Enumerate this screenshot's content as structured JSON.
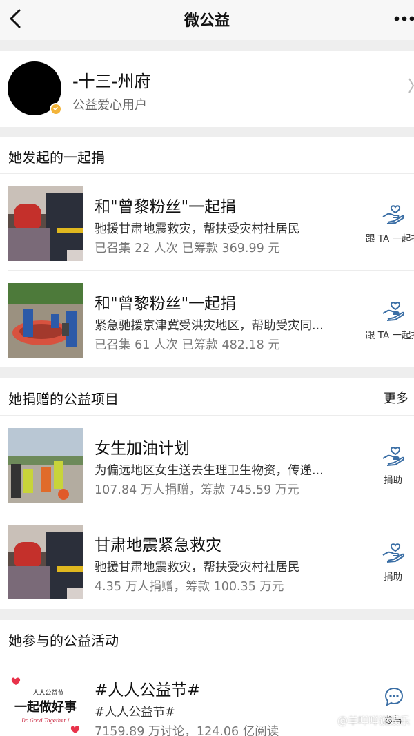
{
  "navbar": {
    "title": "微公益"
  },
  "profile": {
    "name": "-十三-州府",
    "subtitle": "公益爱心用户"
  },
  "initiated": {
    "title": "她发起的一起捐",
    "items": [
      {
        "title": "和\"曾黎粉丝\"一起捐",
        "desc": "驰援甘肃地震救灾，帮扶受灾村社居民",
        "stat": "已召集 22 人次 已筹款 369.99 元",
        "action": "跟 TA 一起捐"
      },
      {
        "title": "和\"曾黎粉丝\"一起捐",
        "desc": "紧急驰援京津冀受洪灾地区，帮助受灾同...",
        "stat": "已召集 61 人次 已筹款 482.18 元",
        "action": "跟 TA 一起捐"
      }
    ]
  },
  "donated": {
    "title": "她捐赠的公益项目",
    "more": "更多",
    "items": [
      {
        "title": "女生加油计划",
        "desc": "为偏远地区女生送去生理卫生物资，传递...",
        "stat": "107.84 万人捐赠，筹款 745.59 万元",
        "action": "捐助"
      },
      {
        "title": "甘肃地震紧急救灾",
        "desc": "驰援甘肃地震救灾，帮扶受灾村社居民",
        "stat": "4.35 万人捐赠，筹款 100.35 万元",
        "action": "捐助"
      }
    ]
  },
  "activities": {
    "title": "她参与的公益活动",
    "items": [
      {
        "title": "#人人公益节#",
        "desc": "#人人公益节#",
        "stat": "7159.89 万讨论，124.06 亿阅读",
        "action": "参与",
        "thumb_logo": "人人公益节",
        "thumb_main": "一起做好事",
        "thumb_sub": "Do Good Together !"
      }
    ]
  },
  "watermark": "@羊咩咩说娱乐",
  "icons": {
    "back": "chevron-left-icon",
    "more": "more-dots-icon",
    "donate": "hand-heart-icon",
    "comment": "chat-bubble-icon",
    "verified": "verified-badge-icon"
  },
  "colors": {
    "accent": "#3a6ea5",
    "badge": "#f3b43a",
    "background": "#eeeeee"
  }
}
